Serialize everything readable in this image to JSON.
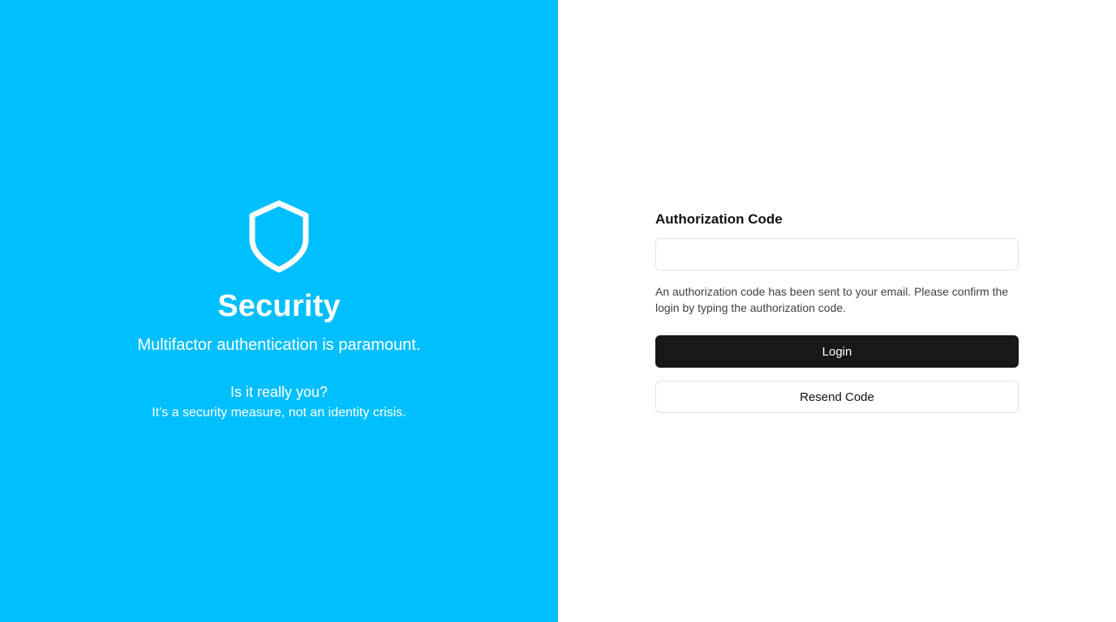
{
  "colors": {
    "hero_background": "#00bfff",
    "hero_text": "#ffffff",
    "primary_button": "#18181b",
    "input_border": "#e3e3e6"
  },
  "hero": {
    "icon": "shield-icon",
    "title": "Security",
    "subtitle": "Multifactor authentication is paramount.",
    "question": "Is it really you?",
    "note": "It's a security measure, not an identity crisis."
  },
  "form": {
    "label": "Authorization Code",
    "input_value": "",
    "input_placeholder": "",
    "help_text": "An authorization code has been sent to your email. Please confirm the login by typing the authorization code.",
    "login_label": "Login",
    "resend_label": "Resend Code"
  }
}
